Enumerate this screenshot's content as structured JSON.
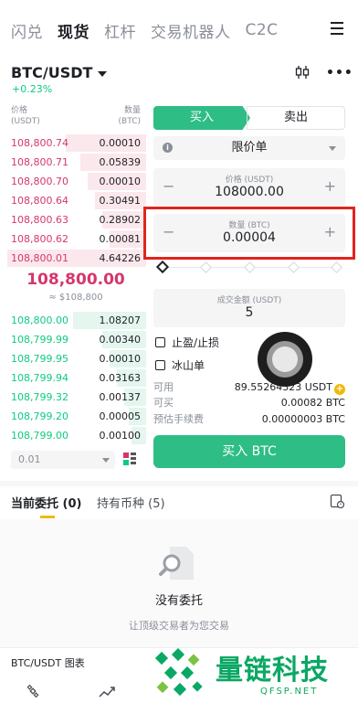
{
  "nav": {
    "tabs": [
      "闪兑",
      "现货",
      "杠杆",
      "交易机器人",
      "C2C"
    ],
    "active_index": 1
  },
  "pair": {
    "symbol": "BTC/USDT",
    "change": "+0.23%"
  },
  "orderbook": {
    "header": {
      "price_label": "价格",
      "price_unit": "(USDT)",
      "qty_label": "数量",
      "qty_unit": "(BTC)"
    },
    "asks": [
      {
        "price": "108,800.74",
        "qty": "0.00010",
        "depth": 0.55
      },
      {
        "price": "108,800.71",
        "qty": "0.05839",
        "depth": 0.45
      },
      {
        "price": "108,800.70",
        "qty": "0.00010",
        "depth": 0.4
      },
      {
        "price": "108,800.64",
        "qty": "0.30491",
        "depth": 0.35
      },
      {
        "price": "108,800.63",
        "qty": "0.28902",
        "depth": 0.3
      },
      {
        "price": "108,800.62",
        "qty": "0.00081",
        "depth": 0.25
      },
      {
        "price": "108,800.01",
        "qty": "4.64226",
        "depth": 0.95
      }
    ],
    "last_price": "108,800.00",
    "last_price_fiat": "≈ $108,800",
    "bids": [
      {
        "price": "108,800.00",
        "qty": "1.08207",
        "depth": 0.5
      },
      {
        "price": "108,799.99",
        "qty": "0.00340",
        "depth": 0.3
      },
      {
        "price": "108,799.95",
        "qty": "0.00010",
        "depth": 0.25
      },
      {
        "price": "108,799.94",
        "qty": "0.03163",
        "depth": 0.2
      },
      {
        "price": "108,799.32",
        "qty": "0.00137",
        "depth": 0.15
      },
      {
        "price": "108,799.20",
        "qty": "0.00005",
        "depth": 0.12
      },
      {
        "price": "108,799.00",
        "qty": "0.00100",
        "depth": 0.1
      }
    ],
    "depth_step": "0.01"
  },
  "form": {
    "buy_label": "买入",
    "sell_label": "卖出",
    "order_type": "限价单",
    "price_caption": "价格 (USDT)",
    "price_value": "108000.00",
    "qty_caption": "数量 (BTC)",
    "qty_value": "0.00004",
    "total_caption": "成交金额 (USDT)",
    "total_value": "5",
    "tpsl_label": "止盈/止损",
    "iceberg_label": "冰山单",
    "available_label": "可用",
    "available_value": "89.55264323 USDT",
    "can_buy_label": "可买",
    "can_buy_value": "0.00082 BTC",
    "fee_label": "预估手续费",
    "fee_value": "0.00000003 BTC",
    "submit_label": "买入 BTC",
    "minus_sign": "−",
    "plus_sign": "+"
  },
  "orders": {
    "tab_open": "当前委托 (0)",
    "tab_holdings": "持有币种 (5)",
    "empty_title": "没有委托",
    "empty_subtitle": "让顶级交易者为您交易"
  },
  "bottom": {
    "chart_label": "BTC/USDT 图表"
  },
  "watermark": {
    "text": "量链科技",
    "url": "QFSP.NET"
  },
  "colors": {
    "ask": "#d5376a",
    "bid": "#0ecb81",
    "buy": "#2ebd85",
    "accent": "#f0b90b",
    "highlight": "#e0241e",
    "watermark": "#0aa864"
  },
  "icons": [
    "hamburger-menu-icon",
    "candlestick-chart-icon",
    "more-icon",
    "info-icon",
    "layout-icon",
    "order-history-icon",
    "empty-search-icon",
    "binance-logo-icon",
    "trend-chart-icon"
  ]
}
